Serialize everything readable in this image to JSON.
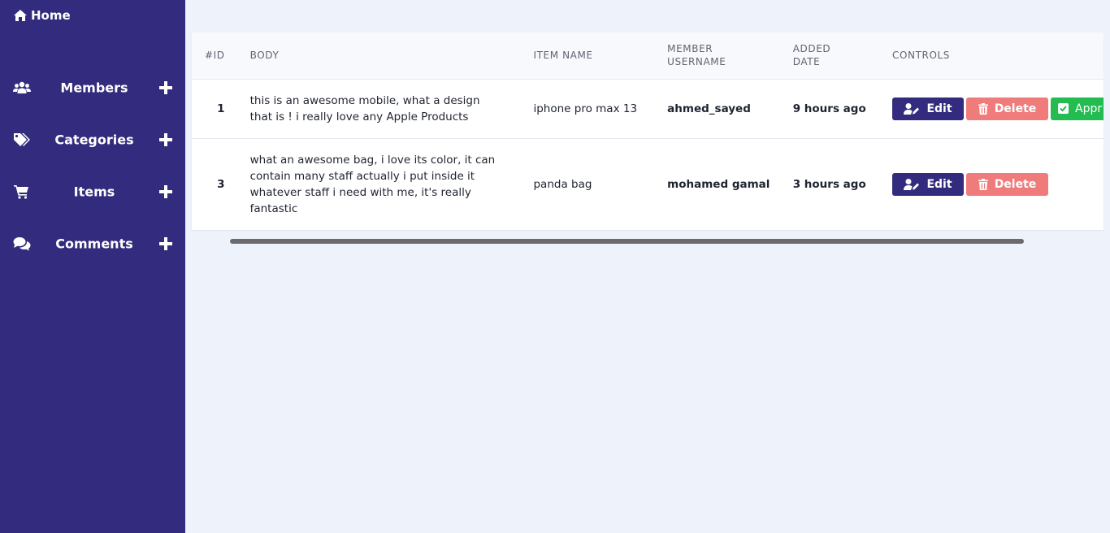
{
  "sidebar": {
    "home_label": "Home",
    "items": [
      {
        "label": "Members",
        "icon": "users-icon"
      },
      {
        "label": "Categories",
        "icon": "tags-icon"
      },
      {
        "label": "Items",
        "icon": "cart-icon"
      },
      {
        "label": "Comments",
        "icon": "comments-icon"
      }
    ]
  },
  "table": {
    "headers": {
      "id": "#ID",
      "body": "BODY",
      "item_name": "ITEM NAME",
      "member_username_1": "MEMBER",
      "member_username_2": "USERNAME",
      "added_date_1": "ADDED",
      "added_date_2": "DATE",
      "controls": "CONTROLS"
    },
    "rows": [
      {
        "id": "1",
        "body": "this is an awesome mobile, what a design that is ! i really love any Apple Products",
        "item_name": "iphone pro max 13",
        "member": "ahmed_sayed",
        "date": "9 hours ago",
        "edit": "Edit",
        "delete": "Delete",
        "approve": "Appr"
      },
      {
        "id": "3",
        "body": "what an awesome bag, i love its color, it can contain many staff actually i put inside it whatever staff i need with me, it's really fantastic",
        "item_name": "panda bag",
        "member": "mohamed gamal",
        "date": "3 hours ago",
        "edit": "Edit",
        "delete": "Delete"
      }
    ]
  },
  "colors": {
    "sidebar_bg": "#332c7e",
    "page_bg": "#eef2fb",
    "edit_btn": "#332c7e",
    "delete_btn": "#f07b7b",
    "approve_btn": "#22bc50"
  }
}
